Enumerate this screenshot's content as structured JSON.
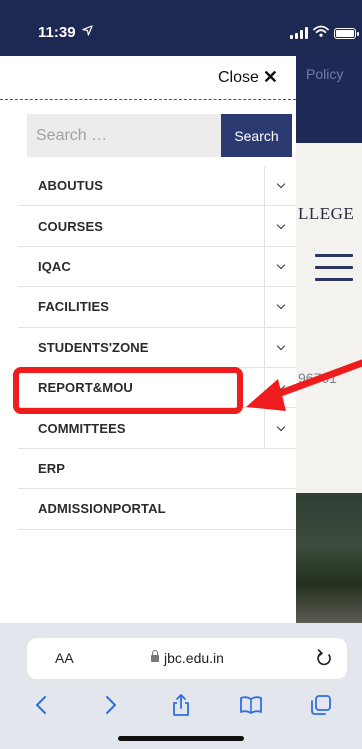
{
  "status_bar": {
    "time": "11:39",
    "location_icon": "location-arrow-icon",
    "icons": [
      "signal-icon",
      "wifi-icon",
      "battery-icon"
    ]
  },
  "background": {
    "policy_text": "Policy",
    "college_text": "LLEGE",
    "phone_text": "96701"
  },
  "drawer": {
    "close_label": "Close",
    "search": {
      "placeholder": "Search …",
      "button_label": "Search"
    },
    "menu_items": [
      {
        "label": "ABOUTUS",
        "has_submenu": true
      },
      {
        "label": "COURSES",
        "has_submenu": true
      },
      {
        "label": "IQAC",
        "has_submenu": true
      },
      {
        "label": "FACILITIES",
        "has_submenu": true
      },
      {
        "label": "STUDENTS'ZONE",
        "has_submenu": true
      },
      {
        "label": "REPORT&MOU",
        "has_submenu": true
      },
      {
        "label": "COMMITTEES",
        "has_submenu": true
      },
      {
        "label": "ERP",
        "has_submenu": false
      },
      {
        "label": "ADMISSIONPORTAL",
        "has_submenu": false
      }
    ]
  },
  "annotation": {
    "highlight_color": "#ee1c1c",
    "target": "ERP"
  },
  "safari": {
    "text_size_label": "AA",
    "url": "jbc.edu.in",
    "toolbar_icons": [
      "back-icon",
      "forward-icon",
      "share-icon",
      "bookmarks-icon",
      "tabs-icon"
    ]
  },
  "colors": {
    "accent_navy": "#2c3a72",
    "statusbar_bg": "#1d2952"
  }
}
